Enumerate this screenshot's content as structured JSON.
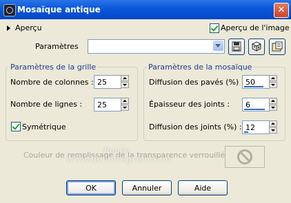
{
  "window": {
    "title": "Mosaïque antique",
    "close_label": "✕"
  },
  "preview": {
    "toggle_label": "Aperçu",
    "checkbox_label": "Aperçu de l'image",
    "checked": true
  },
  "presets": {
    "label": "Paramètres",
    "value": ""
  },
  "grid_group": {
    "title": "Paramètres de la grille",
    "columns_label": "Nombre de colonnes :",
    "columns_value": "25",
    "rows_label": "Nombre de lignes :",
    "rows_value": "25",
    "symmetric_label": "Symétrique",
    "symmetric_checked": true
  },
  "mosaic_group": {
    "title": "Paramètres de la mosaïque",
    "tile_diffusion_label": "Diffusion des pavés (%) :",
    "tile_diffusion_value": "50",
    "grout_thickness_label": "Épaisseur des joints :",
    "grout_thickness_value": "6",
    "grout_diffusion_label": "Diffusion des joints (%) :",
    "grout_diffusion_value": "12"
  },
  "fill": {
    "label": "Couleur de remplissage de la transparence verrouillée :",
    "icon": "no-entry-icon"
  },
  "watermark": {
    "line1": "Renée",
    "line2": "www.maldiregrafics.eu"
  },
  "buttons": {
    "ok": "OK",
    "cancel": "Annuler",
    "help": "Aide"
  },
  "colors": {
    "title_bar": "#0a58d8",
    "group_title": "#1f3c91",
    "dialog_bg": "#ece9d8"
  }
}
